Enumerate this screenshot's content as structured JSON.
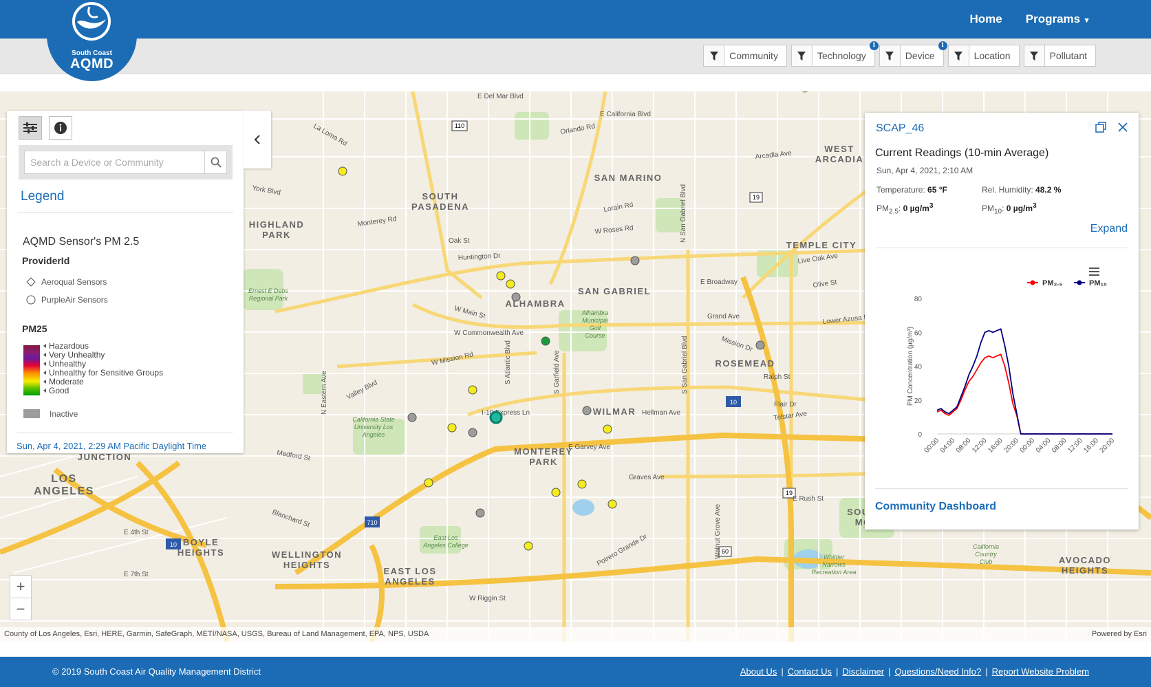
{
  "header": {
    "logo_line1": "South Coast",
    "logo_line2": "AQMD",
    "nav": {
      "home": "Home",
      "programs": "Programs"
    }
  },
  "filters": [
    {
      "label": "Community",
      "info": false
    },
    {
      "label": "Technology",
      "info": true
    },
    {
      "label": "Device",
      "info": true
    },
    {
      "label": "Location",
      "info": false
    },
    {
      "label": "Pollutant",
      "info": false
    }
  ],
  "left_panel": {
    "search_placeholder": "Search a Device or Community",
    "legend_title": "Legend",
    "layer_title": "AQMD Sensor's PM 2.5",
    "field_title": "ProviderId",
    "providers": [
      "Aeroqual Sensors",
      "PurpleAir Sensors"
    ],
    "pm_title": "PM25",
    "pm_classes": [
      "Hazardous",
      "Very Unhealthy",
      "Unhealthy",
      "Unhealthy for Sensitive Groups",
      "Moderate",
      "Good"
    ],
    "inactive_label": "Inactive",
    "timestamp": "Sun, Apr 4, 2021, 2:29 AM Pacific Daylight Time"
  },
  "popup": {
    "title": "SCAP_46",
    "subtitle": "Current Readings (10-min Average)",
    "date": "Sun, Apr 4, 2021, 2:10 AM",
    "temperature_label": "Temperature:",
    "temperature_value": "65 °F",
    "humidity_label": "Rel. Humidity:",
    "humidity_value": "48.2 %",
    "pm25_label": "PM",
    "pm25_sub": "2.5",
    "pm25_value": "0 µg/m",
    "pm10_label": "PM",
    "pm10_sub": "10",
    "pm10_value": "0 µg/m",
    "unit_sup": "3",
    "expand": "Expand",
    "dashboard_link": "Community Dashboard"
  },
  "chart_data": {
    "type": "line",
    "ylabel": "PM Concentration (µg/m³)",
    "ylim": [
      0,
      80
    ],
    "yticks": [
      0,
      20,
      40,
      60,
      80
    ],
    "xticks": [
      "00:00",
      "04:00",
      "08:00",
      "12:00",
      "16:00",
      "20:00",
      "00:00",
      "04:00",
      "08:00",
      "12:00",
      "16:00",
      "20:00"
    ],
    "x_hours": [
      0,
      1,
      2,
      3,
      4,
      5,
      6,
      7,
      8,
      9,
      10,
      11,
      12,
      13,
      14,
      15,
      16,
      17,
      18,
      19,
      20,
      21,
      22,
      23,
      24,
      26,
      30,
      34,
      38,
      40,
      44
    ],
    "series": [
      {
        "name": "PM₂.₅",
        "color": "#ff0000",
        "values": [
          13,
          14,
          12,
          11,
          13,
          15,
          20,
          26,
          31,
          34,
          38,
          42,
          45,
          46,
          45,
          46,
          47,
          40,
          30,
          18,
          11,
          0,
          0,
          0,
          0,
          0,
          0,
          0,
          0,
          0,
          0
        ]
      },
      {
        "name": "PM₁₀",
        "color": "#000080",
        "values": [
          14,
          15,
          13,
          12,
          14,
          16,
          22,
          28,
          35,
          40,
          46,
          54,
          60,
          61,
          60,
          61,
          62,
          52,
          40,
          24,
          12,
          0,
          0,
          0,
          0,
          0,
          0,
          0,
          0,
          0,
          0
        ]
      }
    ]
  },
  "map": {
    "neighborhoods": [
      "SOUTH PASADENA",
      "SAN MARINO",
      "WEST ARCADIA",
      "HIGHLAND PARK",
      "TEMPLE CITY",
      "ALHAMBRA",
      "SAN GABRIEL",
      "ROSEMEAD",
      "WILMAR",
      "MONTEREY PARK",
      "NAUD JUNCTION",
      "LOS ANGELES",
      "BOYLE HEIGHTS",
      "WELLINGTON HEIGHTS",
      "EAST LOS ANGELES",
      "SOUTH EL MONTE",
      "AVOCADO HEIGHTS"
    ],
    "streets": [
      "E Del Mar Blvd",
      "E California Blvd",
      "Orlando Rd",
      "La Loma Rd",
      "York Blvd",
      "Huntington Dr",
      "W Main St",
      "W Commonwealth Ave",
      "W Mission Rd",
      "I-10 Express Ln",
      "E Garvey Ave",
      "Graves Ave",
      "Valley Blvd",
      "E Broadway",
      "Live Oak Ave",
      "Olive St",
      "Potrero Grande Dr",
      "W Riggin St",
      "Medford St",
      "Blanchard St",
      "E 4th St",
      "E 7th St",
      "Hellman Ave",
      "Flair Dr",
      "Telstar Ave",
      "Ralph St",
      "Lower Azusa Rd",
      "W Roses Rd",
      "Lorain Rd",
      "Oak St",
      "Arcadia Ave",
      "Monterey Rd",
      "N Eastern Ave",
      "S Atlantic Blvd",
      "S Garfield Ave",
      "S San Gabriel Blvd",
      "N San Gabriel Blvd",
      "Walnut Grove Ave",
      "E Rush St",
      "Mission Dr",
      "Grand Ave"
    ],
    "places": [
      "Alhambra Municipal Golf Course",
      "California State University Los Angeles",
      "East Los Angeles College",
      "California Country Club",
      "Whittier Narrows Recreation Area",
      "Ernest E Debs Regional Park"
    ],
    "shields": [
      "110",
      "19",
      "710",
      "10",
      "60"
    ]
  },
  "zoom": {
    "in": "+",
    "out": "−"
  },
  "attribution": {
    "left": "County of Los Angeles, Esri, HERE, Garmin, SafeGraph, METI/NASA, USGS, Bureau of Land Management, EPA, NPS, USDA",
    "right": "Powered by Esri"
  },
  "footer": {
    "copyright": "© 2019 South Coast Air Quality Management District",
    "links": [
      "About Us",
      "Contact Us",
      "Disclaimer",
      "Questions/Need Info?",
      "Report Website Problem"
    ]
  },
  "colors": {
    "brand": "#1b6cb5",
    "good": "#00a000",
    "moderate": "#f7ee00",
    "inactive": "#9d9d9d"
  }
}
